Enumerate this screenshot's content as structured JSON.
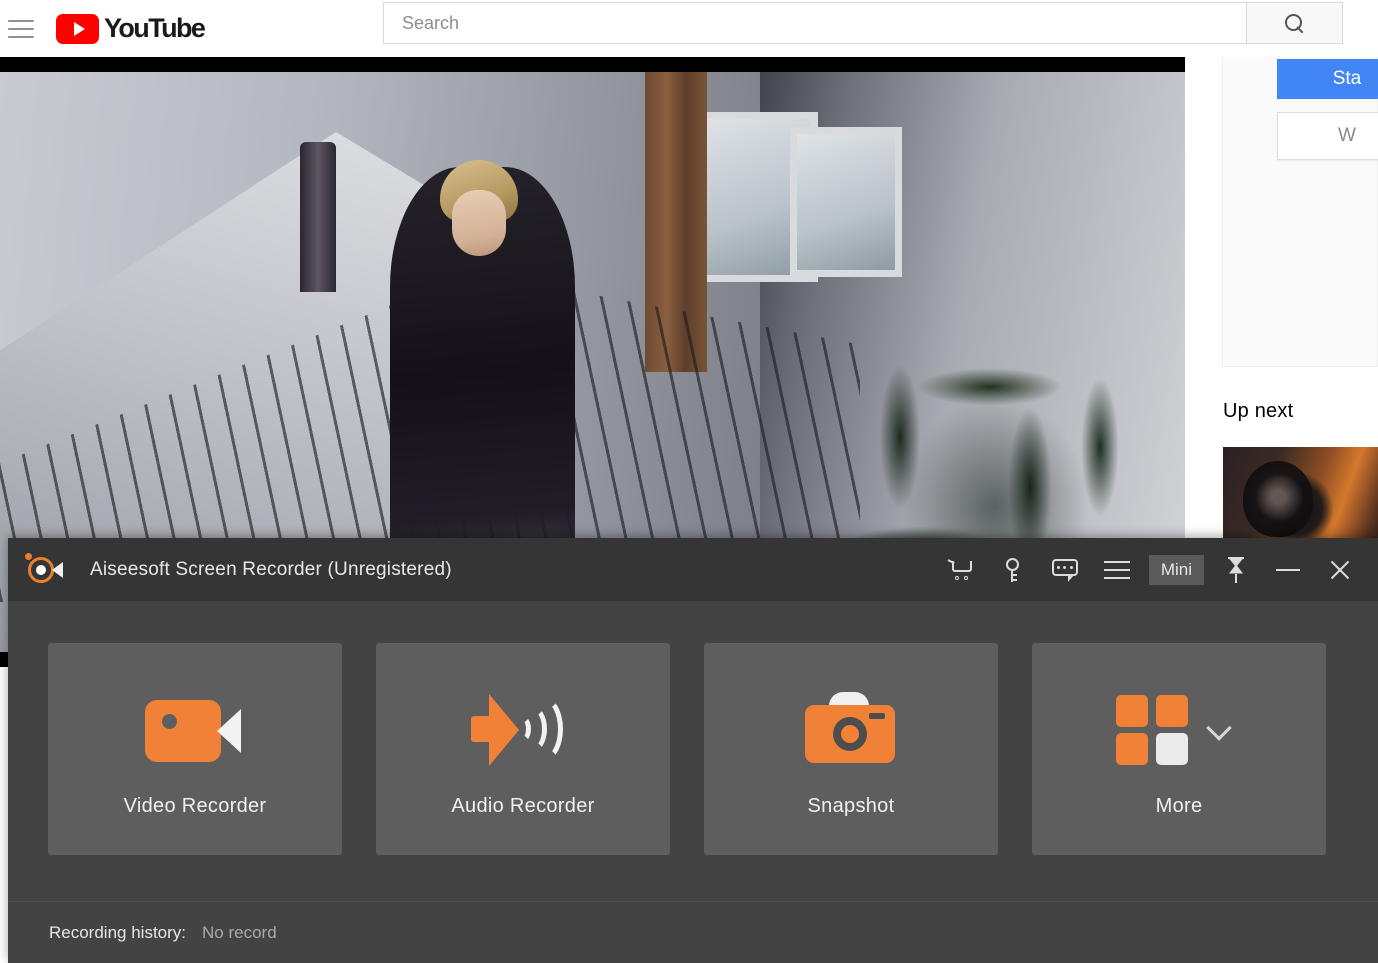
{
  "browser": {
    "site_name": "YouTube",
    "menu_icon": "hamburger-icon",
    "logo_icon": "youtube-logo-icon",
    "search": {
      "placeholder": "Search",
      "value": "",
      "button_icon": "search-icon"
    },
    "player": {
      "label": "video-player"
    },
    "sidebar": {
      "primary_button_label": "Sta",
      "secondary_button_label": "W",
      "up_next_label": "Up next",
      "thumbnail_label": "up-next-thumbnail"
    }
  },
  "app": {
    "title": "Aiseesoft Screen Recorder (Unregistered)",
    "app_icon": "aiseesoft-record-icon",
    "toolbar": [
      {
        "name": "cart-icon",
        "label": "Buy"
      },
      {
        "name": "key-icon",
        "label": "Register"
      },
      {
        "name": "chat-icon",
        "label": "Feedback"
      },
      {
        "name": "menu-icon",
        "label": "Menu"
      }
    ],
    "window_controls": {
      "mini_label": "Mini",
      "pin_icon": "pin-icon",
      "minimize_icon": "minimize-icon",
      "close_icon": "close-icon"
    },
    "cards": [
      {
        "label": "Video Recorder",
        "icon": "video-camera-icon"
      },
      {
        "label": "Audio Recorder",
        "icon": "speaker-icon"
      },
      {
        "label": "Snapshot",
        "icon": "camera-icon"
      },
      {
        "label": "More",
        "icon": "grid-squares-icon",
        "has_chevron": true
      }
    ],
    "footer": {
      "history_label": "Recording history:",
      "history_value": "No record"
    },
    "colors": {
      "accent": "#f08137",
      "titlebar": "#353535",
      "body": "#434343",
      "card": "#5e5e5e",
      "brand_blue": "#4285f4",
      "youtube_red": "#ff0000"
    }
  }
}
